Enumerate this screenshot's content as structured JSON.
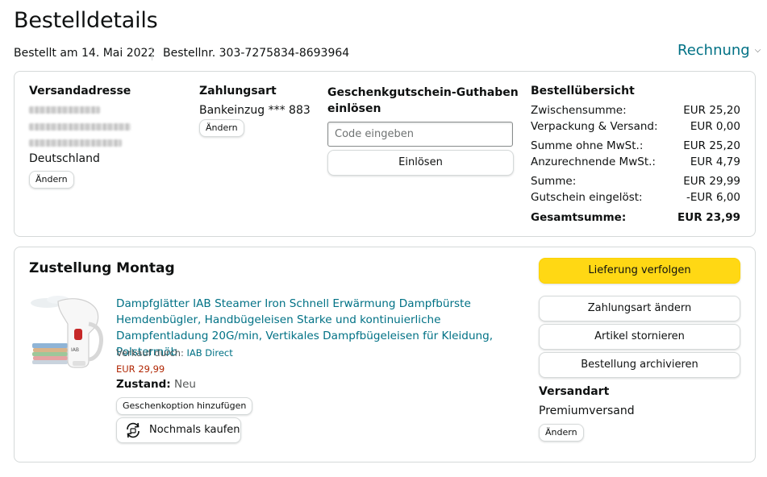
{
  "page": {
    "title": "Bestelldetails",
    "ordered_on": "Bestellt am 14. Mai 2022",
    "order_number": "Bestellnr. 303-7275834-8693964",
    "invoice_label": "Rechnung"
  },
  "shipping_address": {
    "heading": "Versandadresse",
    "country": "Deutschland",
    "change_label": "Ändern"
  },
  "payment": {
    "heading": "Zahlungsart",
    "method": "Bankeinzug *** 883",
    "change_label": "Ändern"
  },
  "gift_card": {
    "heading_line1": "Geschenkgutschein-Guthaben",
    "heading_line2": "einlösen",
    "placeholder": "Code eingeben",
    "redeem_label": "Einlösen"
  },
  "summary": {
    "heading": "Bestellübersicht",
    "rows": [
      {
        "label": "Zwischensumme:",
        "value": "EUR 25,20"
      },
      {
        "label": "Verpackung & Versand:",
        "value": "EUR 0,00"
      },
      {
        "label": "Summe ohne MwSt.:",
        "value": "EUR 25,20"
      },
      {
        "label": "Anzurechnende MwSt.:",
        "value": "EUR 4,79"
      },
      {
        "label": "Summe:",
        "value": "EUR 29,99"
      },
      {
        "label": "Gutschein eingelöst:",
        "value": "-EUR 6,00"
      },
      {
        "label": "Gesamtsumme:",
        "value": "EUR 23,99"
      }
    ]
  },
  "delivery": {
    "heading": "Zustellung Montag",
    "product_title": "Dampfglätter IAB Steamer Iron Schnell Erwärmung Dampfbürste Hemdenbügler, Handbügeleisen Starke und kontinuierliche Dampfentladung 20G/min, Vertikales Dampfbügeleisen für Kleidung, Polstermöb",
    "sold_by_label": "Verkauf durch:",
    "seller": "IAB Direct",
    "price": "EUR 29,99",
    "condition_label": "Zustand:",
    "condition_value": "Neu",
    "gift_option_label": "Geschenkoption hinzufügen",
    "buy_again_label": "Nochmals kaufen",
    "track_label": "Lieferung verfolgen",
    "change_payment_label": "Zahlungsart ändern",
    "cancel_label": "Artikel stornieren",
    "archive_label": "Bestellung archivieren",
    "shipping_type_heading": "Versandart",
    "shipping_type": "Premiumversand",
    "shipping_change_label": "Ändern"
  },
  "colors": {
    "link": "#007185",
    "price": "#b12704",
    "track_button": "#ffd814",
    "border": "#d5d9d9"
  }
}
